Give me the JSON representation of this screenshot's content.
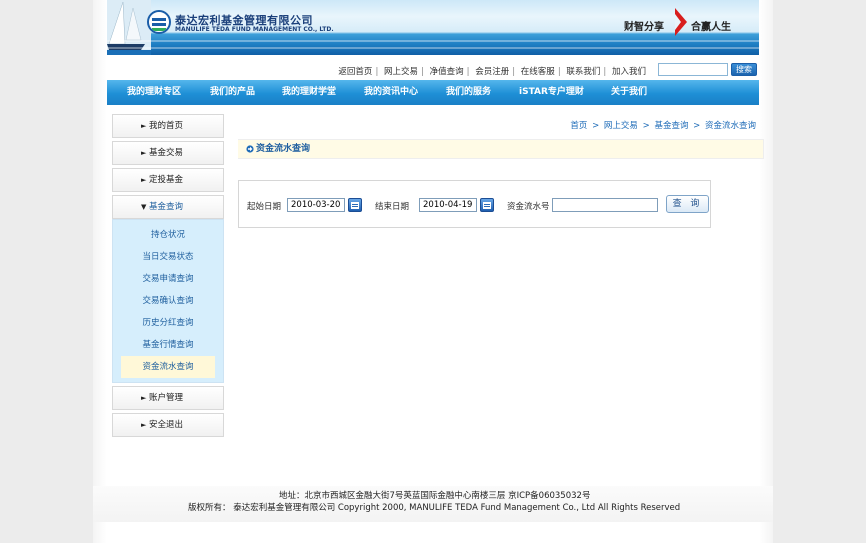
{
  "brand": {
    "name_cn": "泰达宏利基金管理有限公司",
    "name_en": "MANULIFE TEDA FUND MANAGEMENT CO., LTD.",
    "slogan_left": "财智分享",
    "slogan_right": "合赢人生"
  },
  "top_links": {
    "items": [
      "返回首页",
      "网上交易",
      "净值查询",
      "会员注册",
      "在线客服",
      "联系我们",
      "加入我们"
    ],
    "separator": "|",
    "search_button": "搜索"
  },
  "nav": {
    "items": [
      "我的理财专区",
      "我们的产品",
      "我的理财学堂",
      "我的资讯中心",
      "我们的服务",
      "iSTAR专户理财",
      "关于我们"
    ]
  },
  "breadcrumb": {
    "items": [
      "首页",
      "网上交易",
      "基金查询",
      "资金流水查询"
    ],
    "separator": ">"
  },
  "sidebar": {
    "items": [
      {
        "label": "我的首页",
        "arrow": "►"
      },
      {
        "label": "基金交易",
        "arrow": "►"
      },
      {
        "label": "定投基金",
        "arrow": "►"
      },
      {
        "label": "基金查询",
        "arrow": "▼"
      }
    ],
    "sub_items": [
      "持仓状况",
      "当日交易状态",
      "交易申请查询",
      "交易确认查询",
      "历史分红查询",
      "基金行情查询",
      "资金流水查询"
    ],
    "active_sub": "资金流水查询",
    "bottom_items": [
      {
        "label": "账户管理",
        "arrow": "►"
      },
      {
        "label": "安全退出",
        "arrow": "►"
      }
    ]
  },
  "main": {
    "title": "资金流水查询",
    "form": {
      "start_label": "起始日期",
      "start_value": "2010-03-20",
      "end_label": "结束日期",
      "end_value": "2010-04-19",
      "serial_label": "资金流水号",
      "serial_value": "",
      "query_button": "查 询"
    }
  },
  "footer": {
    "address": "地址：北京市西城区金融大街7号英蓝国际金融中心南楼三层 京ICP备06035032号",
    "copyright": "版权所有： 泰达宏利基金管理有限公司 Copyright 2000, MANULIFE TEDA Fund Management Co., Ltd All Rights Reserved"
  },
  "colors": {
    "nav_blue": "#1e8fd6",
    "link_blue": "#1f6cb8",
    "submenu_bg": "#d6eefc",
    "title_bar_bg": "#fffbe6",
    "slogan_red": "#d81e1e"
  }
}
